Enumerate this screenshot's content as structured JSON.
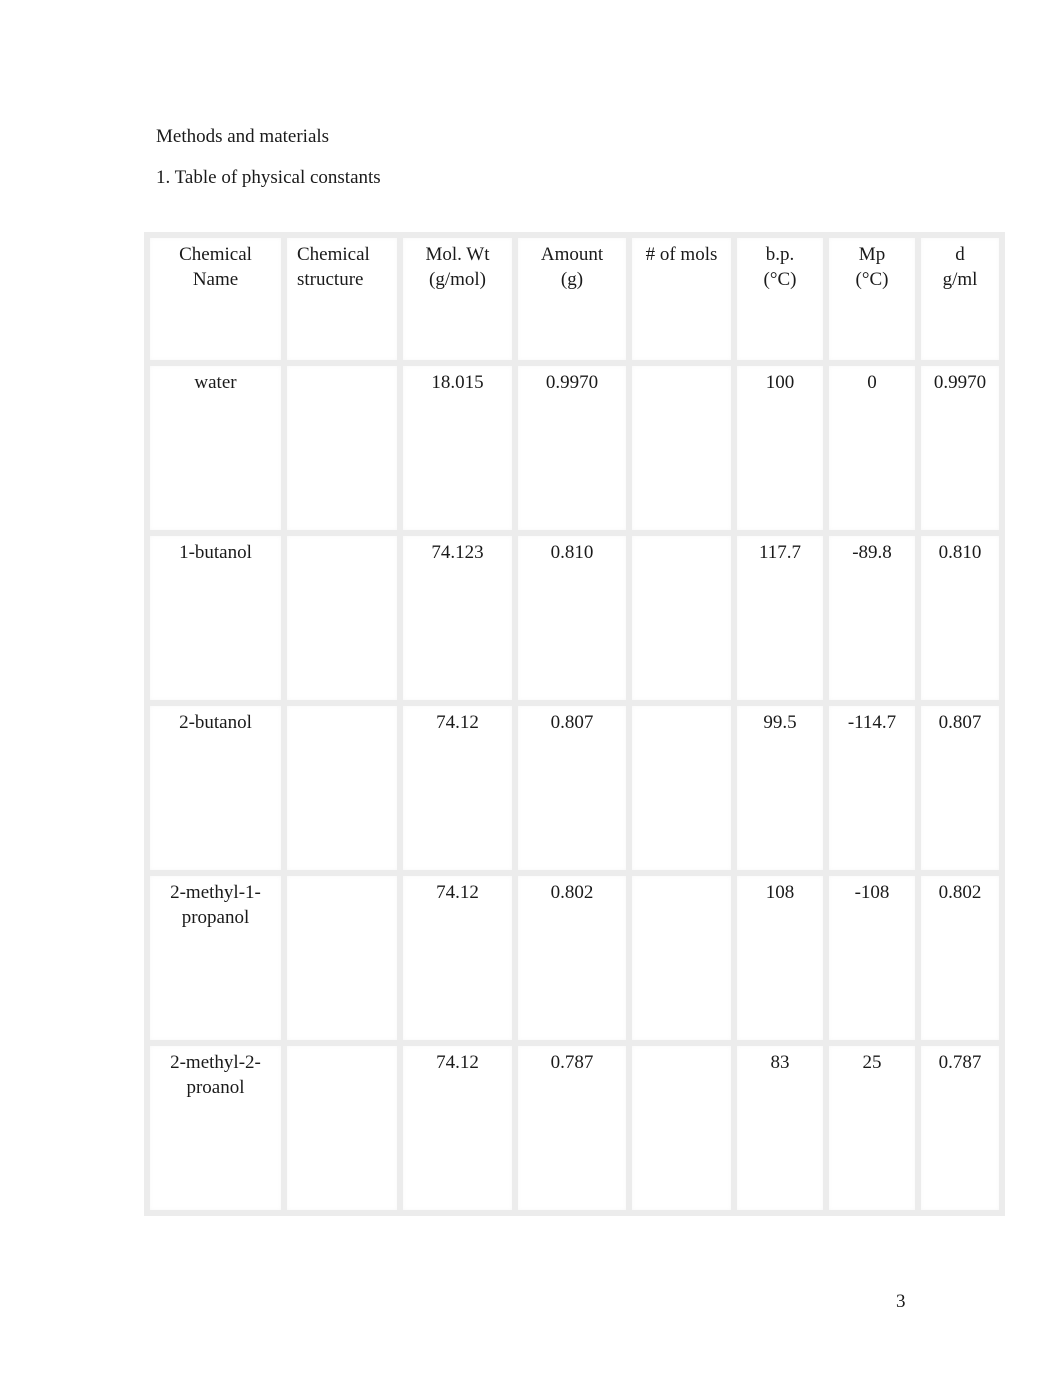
{
  "document": {
    "section_heading": "Methods and materials",
    "subheading": "1. Table of physical constants",
    "page_number": "3"
  },
  "table": {
    "headers": [
      {
        "line1": "Chemical",
        "line2": "Name"
      },
      {
        "line1": "Chemical",
        "line2": "structure"
      },
      {
        "line1": "Mol. Wt",
        "line2": "(g/mol)"
      },
      {
        "line1": "Amount",
        "line2": "(g)"
      },
      {
        "line1": "# of mols",
        "line2": ""
      },
      {
        "line1": "b.p.",
        "line2": "(°C)"
      },
      {
        "line1": "Mp",
        "line2": "(°C)"
      },
      {
        "line1": "d",
        "line2": "g/ml"
      }
    ],
    "rows": [
      {
        "name_line1": "water",
        "name_line2": "",
        "structure": "",
        "mol_wt": "18.015",
        "amount": "0.9970",
        "mols": "",
        "bp": "100",
        "mp": "0",
        "d": "0.9970"
      },
      {
        "name_line1": "1-butanol",
        "name_line2": "",
        "structure": "",
        "mol_wt": "74.123",
        "amount": "0.810",
        "mols": "",
        "bp": "117.7",
        "mp": "-89.8",
        "d": "0.810"
      },
      {
        "name_line1": "2-butanol",
        "name_line2": "",
        "structure": "",
        "mol_wt": "74.12",
        "amount": "0.807",
        "mols": "",
        "bp": "99.5",
        "mp": "-114.7",
        "d": "0.807"
      },
      {
        "name_line1": "2-methyl-1-",
        "name_line2": "propanol",
        "structure": "",
        "mol_wt": "74.12",
        "amount": "0.802",
        "mols": "",
        "bp": "108",
        "mp": "-108",
        "d": "0.802"
      },
      {
        "name_line1": "2-methyl-2-",
        "name_line2": "proanol",
        "structure": "",
        "mol_wt": "74.12",
        "amount": "0.787",
        "mols": "",
        "bp": "83",
        "mp": "25",
        "d": "0.787"
      }
    ]
  }
}
